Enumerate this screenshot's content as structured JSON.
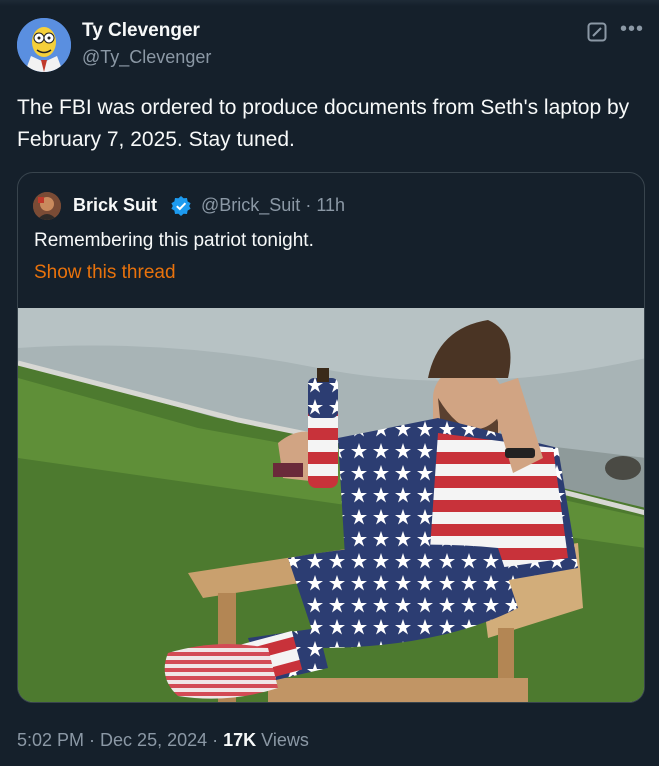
{
  "author": {
    "name": "Ty Clevenger",
    "handle": "@Ty_Clevenger"
  },
  "tweet": {
    "text": "The FBI was ordered to produce documents from Seth's laptop by February 7, 2025. Stay tuned."
  },
  "quoted": {
    "name": "Brick Suit",
    "handle": "@Brick_Suit",
    "separator": " · ",
    "age": "11h",
    "text": "Remembering this patriot tonight.",
    "show_thread": "Show this thread"
  },
  "footer": {
    "time": "5:02 PM",
    "sep1": " · ",
    "date": "Dec 25, 2024",
    "sep2": " · ",
    "views_count": "17K",
    "views_label": " Views"
  },
  "icons": {
    "grok": "grok-icon",
    "more": "more-dots-icon",
    "verified": "verified-badge-icon"
  },
  "colors": {
    "background": "#15202b",
    "secondary_text": "#8b98a5",
    "link": "#e8720c",
    "verified": "#1d9bf0",
    "border": "#38444d"
  }
}
